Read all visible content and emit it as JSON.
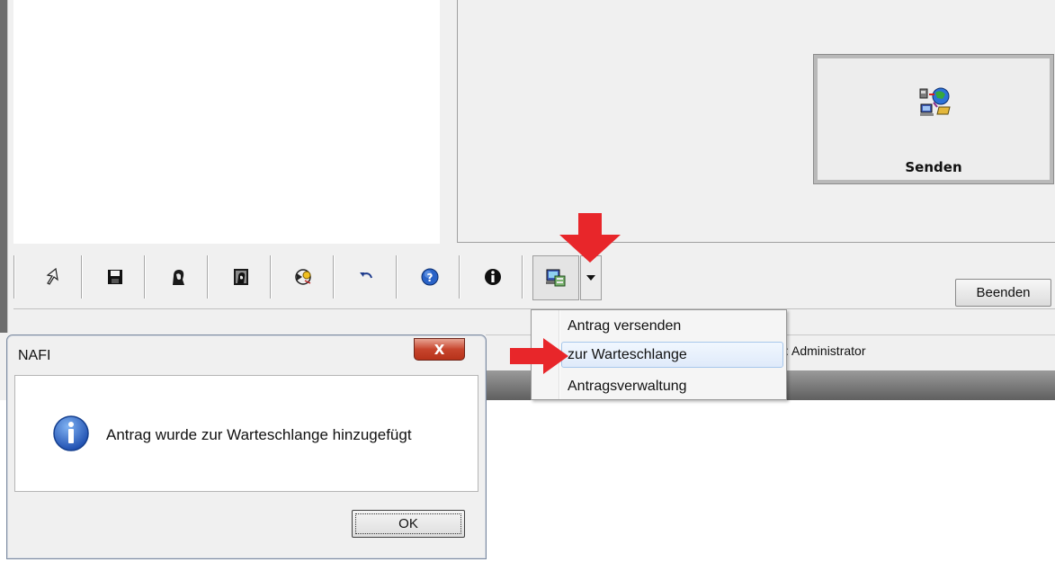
{
  "main": {
    "send_button": {
      "label": "Senden"
    },
    "beenden_button": {
      "label": "Beenden"
    },
    "status_text": ": Administrator"
  },
  "toolbar": {
    "items": [
      {
        "icon": "pointer-icon"
      },
      {
        "icon": "save-icon"
      },
      {
        "icon": "person-icon"
      },
      {
        "icon": "framed-person-icon"
      },
      {
        "icon": "share-icon"
      },
      {
        "icon": "undo-icon"
      },
      {
        "icon": "help-icon"
      },
      {
        "icon": "info-icon"
      },
      {
        "icon": "network-send-icon"
      }
    ]
  },
  "menu": {
    "items": [
      {
        "label": "Antrag versenden"
      },
      {
        "label": "zur Warteschlange",
        "highlighted": true
      },
      {
        "label": "Antragsverwaltung"
      }
    ]
  },
  "dialog": {
    "title": "NAFI",
    "message": "Antrag wurde zur Warteschlange hinzugefügt",
    "ok_label": "OK",
    "close_glyph": "X"
  },
  "colors": {
    "annotation_arrow": "#e8262a",
    "menu_highlight": "#dfeafa",
    "close_button": "#c7452d",
    "info_icon": "#1f63c6"
  }
}
